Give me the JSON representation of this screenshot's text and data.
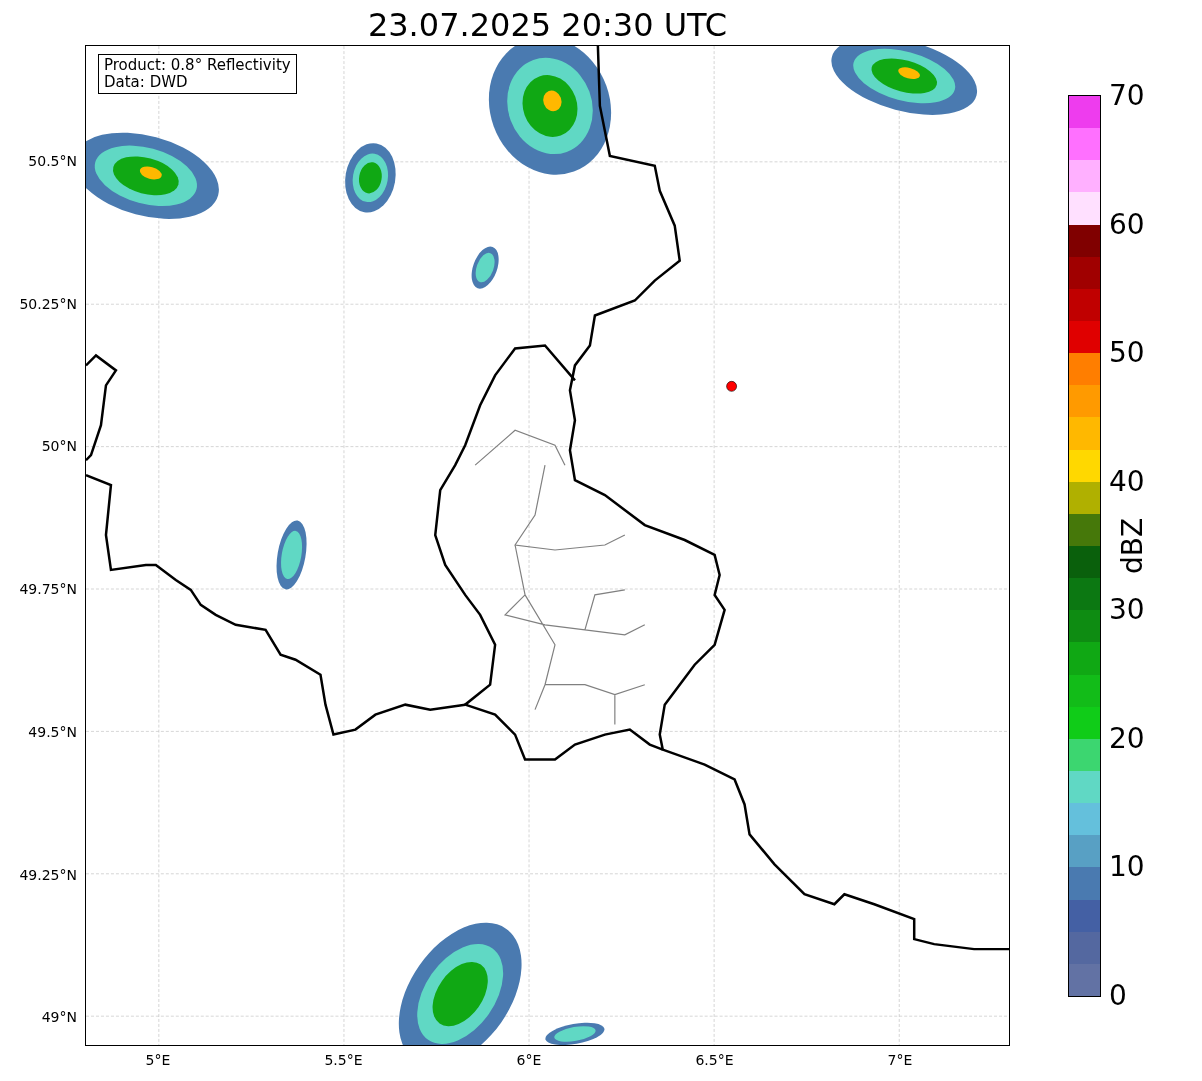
{
  "title": "23.07.2025 20:30 UTC",
  "info_box": [
    "Product: 0.8° Reflectivity",
    "Data: DWD"
  ],
  "y_ticks": [
    "50.5°N",
    "50.25°N",
    "50°N",
    "49.75°N",
    "49.5°N",
    "49.25°N",
    "49°N"
  ],
  "x_ticks": [
    "5°E",
    "5.5°E",
    "6°E",
    "6.5°E",
    "7°E"
  ],
  "colorbar": {
    "label": "dBZ",
    "ticks": [
      "70",
      "60",
      "50",
      "40",
      "30",
      "20",
      "10",
      "0"
    ],
    "segments": [
      {
        "color": "#ee3cee"
      },
      {
        "color": "#ff70ff"
      },
      {
        "color": "#ffb0ff"
      },
      {
        "color": "#ffe0ff"
      },
      {
        "color": "#800000"
      },
      {
        "color": "#a00000"
      },
      {
        "color": "#c00000"
      },
      {
        "color": "#e00000"
      },
      {
        "color": "#ff7e00"
      },
      {
        "color": "#ff9a00"
      },
      {
        "color": "#ffb800"
      },
      {
        "color": "#ffd800"
      },
      {
        "color": "#b0b000"
      },
      {
        "color": "#46780a"
      },
      {
        "color": "#0a600c"
      },
      {
        "color": "#0c7812"
      },
      {
        "color": "#0e8c12"
      },
      {
        "color": "#10a814"
      },
      {
        "color": "#12bc18"
      },
      {
        "color": "#10cc18"
      },
      {
        "color": "#3cd670"
      },
      {
        "color": "#60d8c4"
      },
      {
        "color": "#64c0dc"
      },
      {
        "color": "#58a0c4"
      },
      {
        "color": "#4a7ab0"
      },
      {
        "color": "#4460a4"
      },
      {
        "color": "#5468a0"
      },
      {
        "color": "#6272a4"
      }
    ]
  }
}
